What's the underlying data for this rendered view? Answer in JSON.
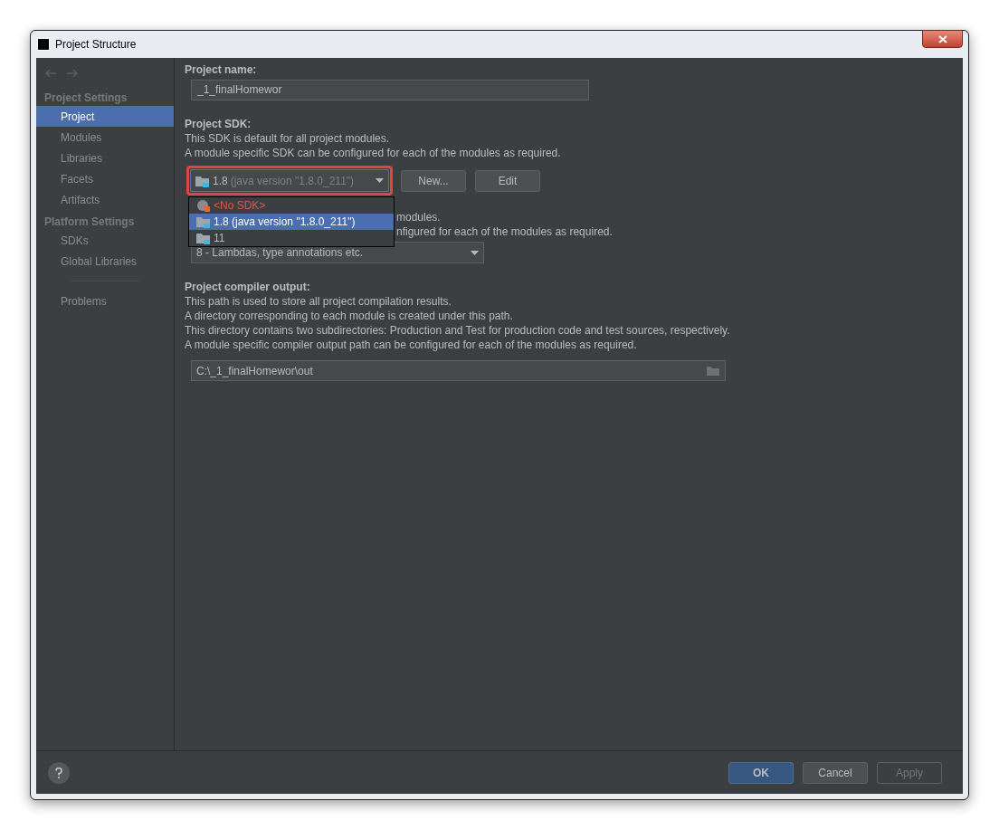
{
  "window": {
    "title": "Project Structure"
  },
  "sidebar": {
    "sections": [
      {
        "heading": "Project Settings",
        "items": [
          {
            "label": "Project",
            "selected": true
          },
          {
            "label": "Modules",
            "selected": false
          },
          {
            "label": "Libraries",
            "selected": false
          },
          {
            "label": "Facets",
            "selected": false
          },
          {
            "label": "Artifacts",
            "selected": false
          }
        ]
      },
      {
        "heading": "Platform Settings",
        "items": [
          {
            "label": "SDKs",
            "selected": false
          },
          {
            "label": "Global Libraries",
            "selected": false
          }
        ]
      }
    ],
    "extra_items": [
      {
        "label": "Problems",
        "selected": false
      }
    ]
  },
  "project_name": {
    "label": "Project name:",
    "value": "_1_finalHomewor"
  },
  "project_sdk": {
    "label": "Project SDK:",
    "lines": [
      "This SDK is default for all project modules.",
      "A module specific SDK can be configured for each of the modules as required."
    ],
    "combo": {
      "version": "1.8",
      "detail": "(java version \"1.8.0_211\")",
      "expanded": true
    },
    "buttons": [
      "New...",
      "Edit"
    ],
    "options": [
      {
        "kind": "none",
        "label": "<No SDK>",
        "selected": false
      },
      {
        "kind": "jdk",
        "label": "1.8 (java version \"1.8.0_211\")",
        "selected": true
      },
      {
        "kind": "jdk",
        "label": "11",
        "selected": false
      }
    ]
  },
  "language_level": {
    "partial_lines": [
      "modules.",
      "nfigured for each of the modules as required."
    ],
    "value": "8 - Lambdas, type annotations etc."
  },
  "compiler_output": {
    "label": "Project compiler output:",
    "lines": [
      "This path is used to store all project compilation results.",
      "A directory corresponding to each module is created under this path.",
      "This directory contains two subdirectories: Production and Test for production code and test sources, respectively.",
      "A module specific compiler output path can be configured for each of the modules as required."
    ],
    "value": "C:\\_1_finalHomewor\\out"
  },
  "footer": {
    "buttons": [
      {
        "label": "OK",
        "kind": "default",
        "disabled": false
      },
      {
        "label": "Cancel",
        "kind": "normal",
        "disabled": false
      },
      {
        "label": "Apply",
        "kind": "normal",
        "disabled": true
      }
    ]
  }
}
